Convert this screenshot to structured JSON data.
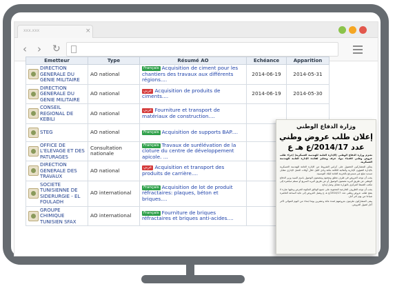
{
  "browser": {
    "tab_title": "xxx.xxx",
    "tab_close": "×",
    "nav_back": "‹",
    "nav_forward": "›",
    "nav_reload": "↻",
    "url": ""
  },
  "table": {
    "headers": [
      "Emetteur",
      "Type",
      "Résumé AO",
      "Echéance",
      "Apparition"
    ],
    "rows": [
      {
        "emetteur": "DIRECTION GENERALE DU GENIE MILITAIRE",
        "type": "AO national",
        "lang": "Français",
        "lang_class": "fr",
        "resume": "Acquisition de ciment pour les chantiers des travaux aux différents régions....",
        "echeance": "2014-06-19",
        "apparition": "2014-05-31"
      },
      {
        "emetteur": "DIRECTION GENERALE DU GENIE MILITAIRE",
        "type": "AO national",
        "lang": "عربي",
        "lang_class": "ar",
        "resume": "Acquisition de produits de ciments....",
        "echeance": "2014-06-19",
        "apparition": "2014-05-30"
      },
      {
        "emetteur": "CONSEIL REGIONAL DE KEBILI",
        "type": "AO national",
        "lang": "عربي",
        "lang_class": "ar",
        "resume": "Fourniture et transport de matériaux de construction....",
        "echeance": "",
        "apparition": ""
      },
      {
        "emetteur": "STEG",
        "type": "AO national",
        "lang": "Français",
        "lang_class": "fr",
        "resume": "Acquisition de supports BAP....",
        "echeance": "",
        "apparition": ""
      },
      {
        "emetteur": "OFFICE DE L'ELEVAGE ET DES PATURAGES",
        "type": "Consultation nationale",
        "lang": "Français",
        "lang_class": "fr",
        "resume": "Travaux de surélévation de la cloture du centre de développement apicole. ...",
        "echeance": "",
        "apparition": ""
      },
      {
        "emetteur": "DIRECTION GENERALE DES TRAVAUX",
        "type": "AO national",
        "lang": "عربي",
        "lang_class": "ar",
        "resume": "Acquisition et transport des produits de carrière....",
        "echeance": "",
        "apparition": ""
      },
      {
        "emetteur": "SOCIETE TUNISIENNE DE SIDERURGIE - EL FOULADH",
        "type": "AO international",
        "lang": "Français",
        "lang_class": "fr",
        "resume": "Acquisition de lot de produit réfractaires: plaques, béton et briques....",
        "echeance": "",
        "apparition": ""
      },
      {
        "emetteur": "GROUPE CHIMIQUE TUNISIEN SFAX",
        "type": "AO international",
        "lang": "Français",
        "lang_class": "fr",
        "resume": "Fourniture de briques réfractaires et briques anti-acides....",
        "echeance": "",
        "apparition": ""
      }
    ]
  },
  "clipping": {
    "ministry": "وزارة الدفاع الوطني",
    "title": "إعلان طلب عروض وطني",
    "number": "عدد 2014/17/ع هـ ع",
    "para1": "تعتزم وزارة الدفاع الوطني (الإدارة العامة للهندسة العسكرية) إجراء طلب عروض وطني لاقتناء مواد خزف وتجليز لفائدة الإدارة العامة للهندسة العسكرية.",
    "para2": "يمكن للمشاركين الحصول على كراس الشروط من الإدارة العامة للهندسة العسكرية بالإدارة الشؤون الإدارية والمالية الكائنة بثكنة وادي الليل خلال أوقات العمل الإداري مقابل تسديد مبلغ غير مسترجع بالخزينة العامة للبلاد التونسية.",
    "para3": "يجب أن توجه العروض في ظرف مغلق ومختوم ومضمون الوصول باسم السيد وزير الدفاع الوطني عن طريق البريد مضمون الوصول أو عن طريق البريد السريع أو تسلم مباشرة إلى مكتب الضبط المركزي بالوزارة مقابل وصل إيداع.",
    "para4": "يجب أن توجه الظروف الخارجية المحتوية على جميع الوثائق المكونة للعرض وعليها عبارة لا يفتح طلب عروض وطني عدد 2014/17/ع هـ ع وتقبل العروض إلى غاية الساعة العاشرة صباحا من يوم آخر أجل.",
    "para5": "يبقى المشاركون ملزمون بعروضهم لمدة مائة وعشرين يوما ابتداء من اليوم الموالي لآخر أجل لقبول العروض."
  }
}
